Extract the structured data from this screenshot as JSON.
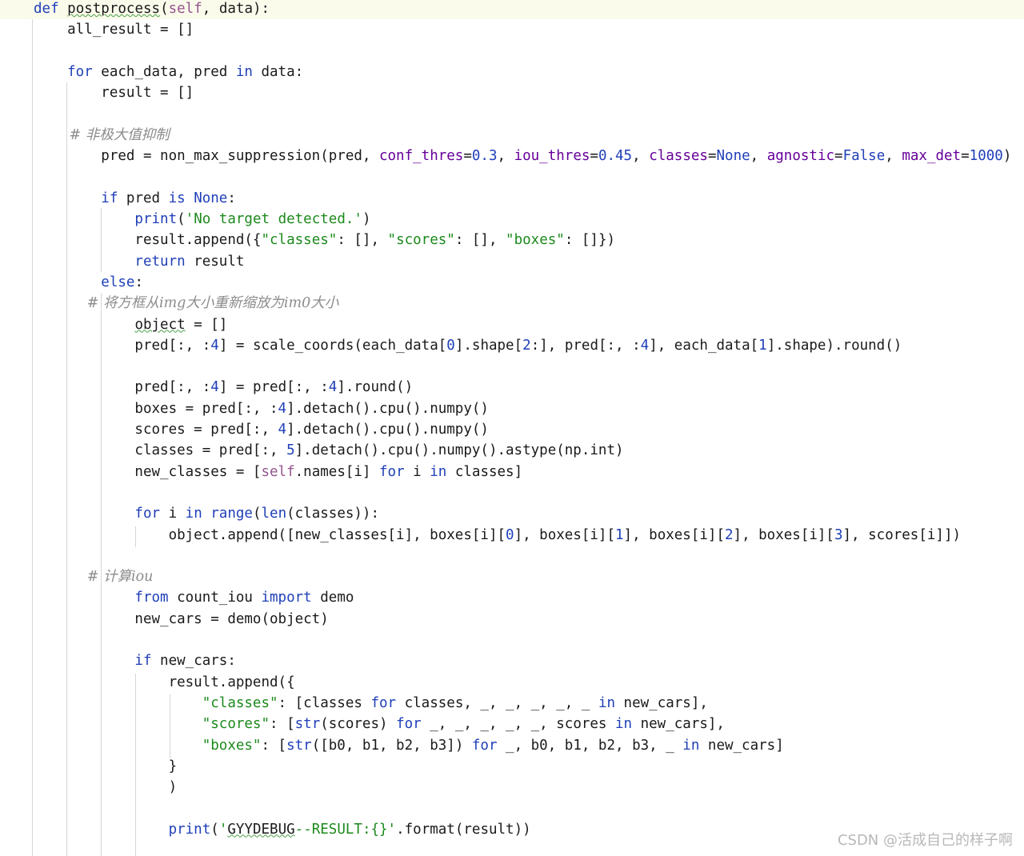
{
  "editor": {
    "colors": {
      "keyword": "#1f3fb8",
      "string": "#1c8a1c",
      "comment": "#8c8c8c",
      "self": "#94558d",
      "param": "#660099",
      "current_line": "#fbfbec"
    },
    "lines": [
      [
        [
          "kw",
          "def "
        ],
        [
          "fn",
          "postprocess"
        ],
        [
          "",
          "("
        ],
        [
          "slf",
          "self"
        ],
        [
          "",
          ", data):"
        ]
      ],
      [
        [
          "",
          "    all_result = []"
        ]
      ],
      [],
      [
        [
          "kw",
          "    for "
        ],
        [
          "",
          "each_data, pred "
        ],
        [
          "kw",
          "in"
        ],
        [
          "",
          " data:"
        ]
      ],
      [
        [
          "",
          "        result = []"
        ]
      ],
      [],
      [
        [
          "cm",
          "        # 非极大值抑制"
        ]
      ],
      [
        [
          "",
          "        pred = non_max_suppression(pred, "
        ],
        [
          "prm",
          "conf_thres"
        ],
        [
          "",
          "="
        ],
        [
          "num",
          "0.3"
        ],
        [
          "",
          ", "
        ],
        [
          "prm",
          "iou_thres"
        ],
        [
          "",
          "="
        ],
        [
          "num",
          "0.45"
        ],
        [
          "",
          ", "
        ],
        [
          "prm",
          "classes"
        ],
        [
          "",
          "="
        ],
        [
          "kw",
          "None"
        ],
        [
          "",
          ", "
        ],
        [
          "prm",
          "agnostic"
        ],
        [
          "",
          "="
        ],
        [
          "kw",
          "False"
        ],
        [
          "",
          ", "
        ],
        [
          "prm",
          "max_det"
        ],
        [
          "",
          "="
        ],
        [
          "num",
          "1000"
        ],
        [
          "",
          ")"
        ]
      ],
      [],
      [
        [
          "kw",
          "        if "
        ],
        [
          "",
          "pred "
        ],
        [
          "kw",
          "is None"
        ],
        [
          "",
          ":"
        ]
      ],
      [
        [
          "bi",
          "            print"
        ],
        [
          "",
          "("
        ],
        [
          "str",
          "'No target detected.'"
        ],
        [
          "",
          ")"
        ]
      ],
      [
        [
          "",
          "            result.append({"
        ],
        [
          "str",
          "\"classes\""
        ],
        [
          "",
          ": [], "
        ],
        [
          "str",
          "\"scores\""
        ],
        [
          "",
          ": [], "
        ],
        [
          "str",
          "\"boxes\""
        ],
        [
          "",
          ": []})"
        ]
      ],
      [
        [
          "kw",
          "            return "
        ],
        [
          "",
          "result"
        ]
      ],
      [
        [
          "kw",
          "        else"
        ],
        [
          "",
          ":"
        ]
      ],
      [
        [
          "cm",
          "            # 将方框从img大小重新缩放为im0大小"
        ]
      ],
      [
        [
          "",
          "            "
        ],
        [
          "wavy",
          "object"
        ],
        [
          "",
          " = []"
        ]
      ],
      [
        [
          "",
          "            pred[:, :"
        ],
        [
          "num",
          "4"
        ],
        [
          "",
          "] = scale_coords(each_data["
        ],
        [
          "num",
          "0"
        ],
        [
          "",
          "].shape["
        ],
        [
          "num",
          "2"
        ],
        [
          "",
          ":], pred[:, :"
        ],
        [
          "num",
          "4"
        ],
        [
          "",
          "], each_data["
        ],
        [
          "num",
          "1"
        ],
        [
          "",
          "].shape).round()"
        ]
      ],
      [],
      [
        [
          "",
          "            pred[:, :"
        ],
        [
          "num",
          "4"
        ],
        [
          "",
          "] = pred[:, :"
        ],
        [
          "num",
          "4"
        ],
        [
          "",
          "].round()"
        ]
      ],
      [
        [
          "",
          "            boxes = pred[:, :"
        ],
        [
          "num",
          "4"
        ],
        [
          "",
          "].detach().cpu().numpy()"
        ]
      ],
      [
        [
          "",
          "            scores = pred[:, "
        ],
        [
          "num",
          "4"
        ],
        [
          "",
          "].detach().cpu().numpy()"
        ]
      ],
      [
        [
          "",
          "            classes = pred[:, "
        ],
        [
          "num",
          "5"
        ],
        [
          "",
          "].detach().cpu().numpy().astype(np.int)"
        ]
      ],
      [
        [
          "",
          "            new_classes = ["
        ],
        [
          "slf",
          "self"
        ],
        [
          "",
          ".names[i] "
        ],
        [
          "kw",
          "for"
        ],
        [
          "",
          " i "
        ],
        [
          "kw",
          "in"
        ],
        [
          "",
          " classes]"
        ]
      ],
      [],
      [
        [
          "kw",
          "            for "
        ],
        [
          "",
          "i "
        ],
        [
          "kw",
          "in "
        ],
        [
          "bi",
          "range"
        ],
        [
          "",
          "("
        ],
        [
          "bi",
          "len"
        ],
        [
          "",
          "(classes)):"
        ]
      ],
      [
        [
          "",
          "                object.append([new_classes[i], boxes[i]["
        ],
        [
          "num",
          "0"
        ],
        [
          "",
          "], boxes[i]["
        ],
        [
          "num",
          "1"
        ],
        [
          "",
          "], boxes[i]["
        ],
        [
          "num",
          "2"
        ],
        [
          "",
          "], boxes[i]["
        ],
        [
          "num",
          "3"
        ],
        [
          "",
          "], scores[i]])"
        ]
      ],
      [],
      [
        [
          "cm",
          "            # 计算iou"
        ]
      ],
      [
        [
          "kw",
          "            from "
        ],
        [
          "",
          "count_iou "
        ],
        [
          "kw",
          "import "
        ],
        [
          "",
          "demo"
        ]
      ],
      [
        [
          "",
          "            new_cars = demo(object)"
        ]
      ],
      [],
      [
        [
          "kw",
          "            if "
        ],
        [
          "",
          "new_cars:"
        ]
      ],
      [
        [
          "",
          "                result.append({"
        ]
      ],
      [
        [
          "str",
          "                    \"classes\""
        ],
        [
          "",
          ": [classes "
        ],
        [
          "kw",
          "for"
        ],
        [
          "",
          " classes, _, _, _, _, _ "
        ],
        [
          "kw",
          "in"
        ],
        [
          "",
          " new_cars],"
        ]
      ],
      [
        [
          "str",
          "                    \"scores\""
        ],
        [
          "",
          ": ["
        ],
        [
          "bi",
          "str"
        ],
        [
          "",
          "(scores) "
        ],
        [
          "kw",
          "for"
        ],
        [
          "",
          " _, _, _, _, _, scores "
        ],
        [
          "kw",
          "in"
        ],
        [
          "",
          " new_cars],"
        ]
      ],
      [
        [
          "str",
          "                    \"boxes\""
        ],
        [
          "",
          ": ["
        ],
        [
          "bi",
          "str"
        ],
        [
          "",
          "([b0, b1, b2, b3]) "
        ],
        [
          "kw",
          "for"
        ],
        [
          "",
          " _, b0, b1, b2, b3, _ "
        ],
        [
          "kw",
          "in"
        ],
        [
          "",
          " new_cars]"
        ]
      ],
      [
        [
          "",
          "                }"
        ]
      ],
      [
        [
          "",
          "                )"
        ]
      ],
      [],
      [
        [
          "bi",
          "                print"
        ],
        [
          "",
          "("
        ],
        [
          "str",
          "'"
        ],
        [
          "wavy",
          "GYYDEBUG"
        ],
        [
          "str",
          "--RESULT:{}'"
        ],
        [
          "",
          ".format(result))"
        ]
      ]
    ]
  },
  "watermark": "CSDN @活成自己的样子啊"
}
